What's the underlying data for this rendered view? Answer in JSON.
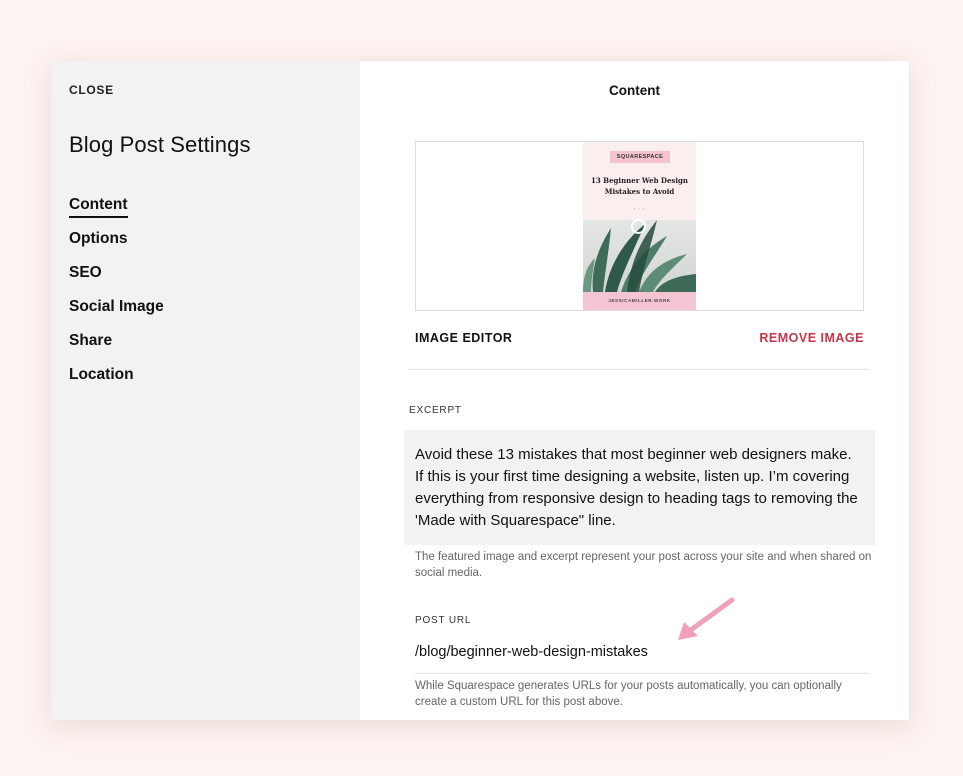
{
  "sidebar": {
    "close_label": "CLOSE",
    "title": "Blog Post Settings",
    "items": [
      {
        "label": "Content"
      },
      {
        "label": "Options"
      },
      {
        "label": "SEO"
      },
      {
        "label": "Social Image"
      },
      {
        "label": "Share"
      },
      {
        "label": "Location"
      }
    ]
  },
  "main": {
    "title": "Content",
    "image": {
      "thumb_tag": "SQUARESPACE",
      "thumb_title": "13 Beginner Web Design Mistakes to Avoid",
      "thumb_footer": "JESSICAMILLER.WORK",
      "editor_label": "IMAGE EDITOR",
      "remove_label": "REMOVE IMAGE"
    },
    "excerpt": {
      "label": "EXCERPT",
      "text": "Avoid these 13 mistakes that most beginner web designers make. If this is your first time designing a website, listen up. I’m covering everything from responsive design to heading tags to removing the 'Made with Squarespace\" line.",
      "help": "The featured image and excerpt represent your post across your site and when shared on social media."
    },
    "post_url": {
      "label": "POST URL",
      "value": "/blog/beginner-web-design-mistakes",
      "help": "While Squarespace generates URLs for your posts automatically, you can optionally create a custom URL for this post above."
    }
  },
  "colors": {
    "background": "#fdf3f1",
    "sidebar": "#f2f2f2",
    "remove": "#c6354a",
    "arrow": "#f0a0b8"
  }
}
